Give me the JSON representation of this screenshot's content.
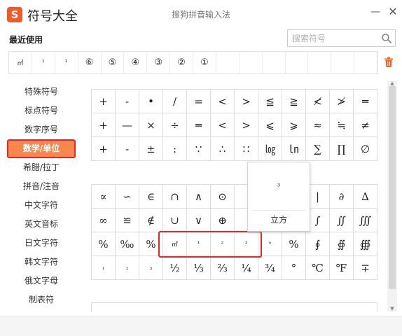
{
  "app": {
    "logo_letter": "S",
    "title": "符号大全",
    "window_title": "搜狗拼音输入法",
    "minimize_glyph": "—",
    "close_glyph": "✕"
  },
  "recent": {
    "label": "最近使用",
    "search_placeholder": "搜索符号",
    "items": [
      "㎥",
      "¹",
      "²",
      "⑥",
      "⑤",
      "④",
      "③",
      "②",
      "①",
      "",
      "",
      "",
      "",
      "",
      "",
      ""
    ]
  },
  "sidebar": {
    "items": [
      {
        "label": "特殊符号",
        "active": false
      },
      {
        "label": "标点符号",
        "active": false
      },
      {
        "label": "数字序号",
        "active": false
      },
      {
        "label": "数学/单位",
        "active": true
      },
      {
        "label": "希腊/拉丁",
        "active": false
      },
      {
        "label": "拼音/注音",
        "active": false
      },
      {
        "label": "中文字符",
        "active": false
      },
      {
        "label": "英文音标",
        "active": false
      },
      {
        "label": "日文字符",
        "active": false
      },
      {
        "label": "韩文字符",
        "active": false
      },
      {
        "label": "俄文字母",
        "active": false
      },
      {
        "label": "制表符",
        "active": false
      }
    ]
  },
  "grid_top": [
    "+",
    "-",
    "•",
    "/",
    "=",
    "<",
    ">",
    "≦",
    "≧",
    "≮",
    "≯",
    "═",
    "+",
    "—",
    "×",
    "÷",
    "═",
    "<",
    ">",
    "⩽",
    "⩾",
    "≈",
    "≒",
    "≠",
    "+",
    "-",
    "±",
    ":",
    "∵",
    "∴",
    "∷",
    "㏒",
    "㏑",
    "∑",
    "∏",
    "∅"
  ],
  "grid_bottom": [
    "∝",
    "∽",
    "∈",
    "∩",
    "∧",
    "⊙",
    "",
    "",
    "",
    "|",
    "∂",
    "∆",
    "∞",
    "≌",
    "∉",
    "∪",
    "∨",
    "⊕",
    "",
    "",
    "",
    "∫",
    "∬",
    "∭",
    "%",
    "‰",
    "%",
    "㎥",
    "¹",
    "²",
    "³",
    "ⁿ",
    "%",
    "∮",
    "∯",
    "∰",
    "₁",
    "₂",
    "₃",
    "½",
    "⅓",
    "⅔",
    "¼",
    "¾",
    "°",
    "℃",
    "℉",
    "∓"
  ],
  "popup": {
    "char": "³",
    "label": "立方"
  }
}
